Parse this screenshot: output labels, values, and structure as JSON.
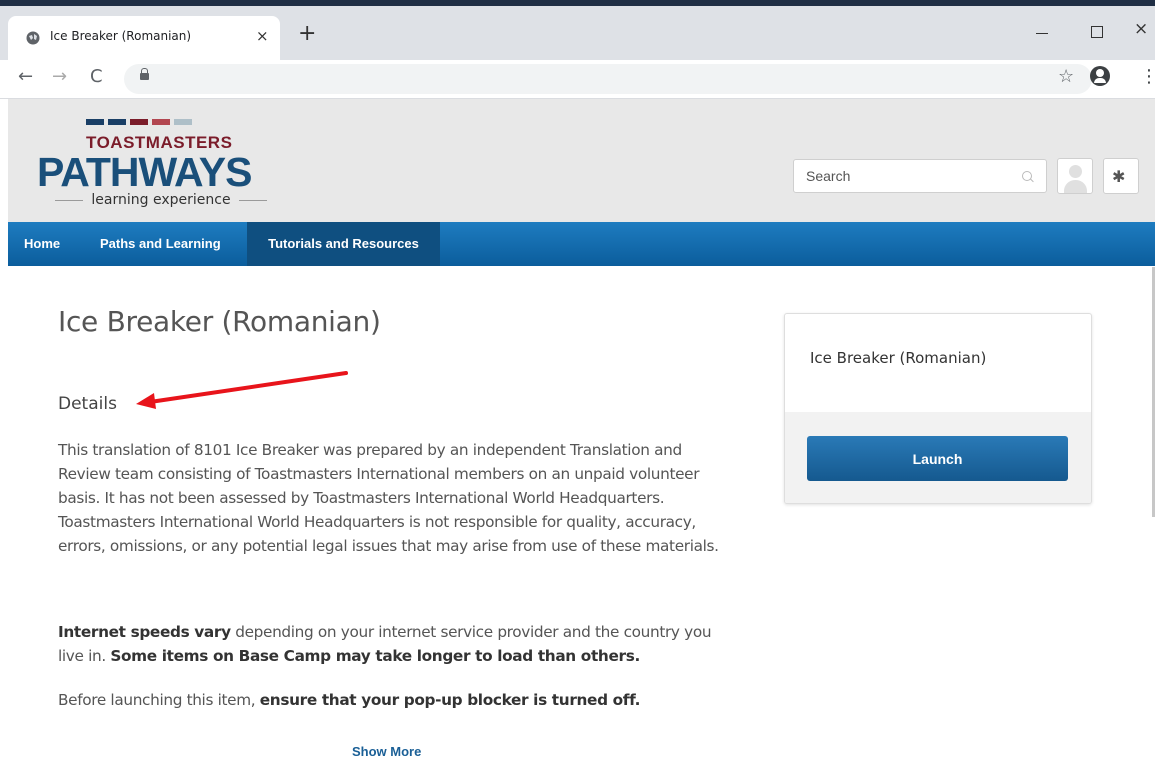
{
  "browser": {
    "tab_title": "Ice Breaker (Romanian)",
    "tab_close": "×",
    "new_tab": "+",
    "back": "←",
    "forward": "→",
    "reload": "C",
    "star": "☆",
    "menu": "⋮",
    "win_close": "×"
  },
  "site": {
    "logo": {
      "line1": "TOASTMASTERS",
      "line2": "PATHWAYS",
      "line3": "learning experience",
      "bar_colors": [
        "#1a3f66",
        "#1a3f66",
        "#7b1c2a",
        "#b24650",
        "#aebfc8"
      ]
    },
    "search_placeholder": "Search",
    "gear_glyph": "✱"
  },
  "nav": {
    "items": [
      {
        "label": "Home",
        "active": false
      },
      {
        "label": "Paths and Learning",
        "active": false
      },
      {
        "label": "Tutorials and Resources",
        "active": true
      }
    ]
  },
  "main": {
    "title": "Ice Breaker (Romanian)",
    "details_heading": "Details",
    "paragraph1": "This translation of 8101 Ice Breaker was prepared by an independent Translation and Review team consisting of Toastmasters International members on an unpaid volunteer basis. It has not been assessed by Toastmasters International World Headquarters. Toastmasters International World Headquarters is not responsible for quality, accuracy, errors, omissions, or any potential legal issues that may arise from use of these materials.",
    "paragraph2": {
      "bold1": "Internet speeds vary",
      "text1": " depending on your internet service provider and the country you live in. ",
      "bold2": "Some items on Base Camp may take longer to load than others."
    },
    "paragraph3": {
      "text1": "Before launching this item, ",
      "bold1": "ensure that your pop-up blocker is turned off."
    },
    "show_more": "Show More"
  },
  "card": {
    "title": "Ice Breaker (Romanian)",
    "launch_label": "Launch"
  },
  "colors": {
    "nav_blue": "#0b5d9c",
    "annotation_arrow": "#e8141b",
    "brand_maroon": "#7b1c2a",
    "brand_blue": "#1a4f7a"
  }
}
